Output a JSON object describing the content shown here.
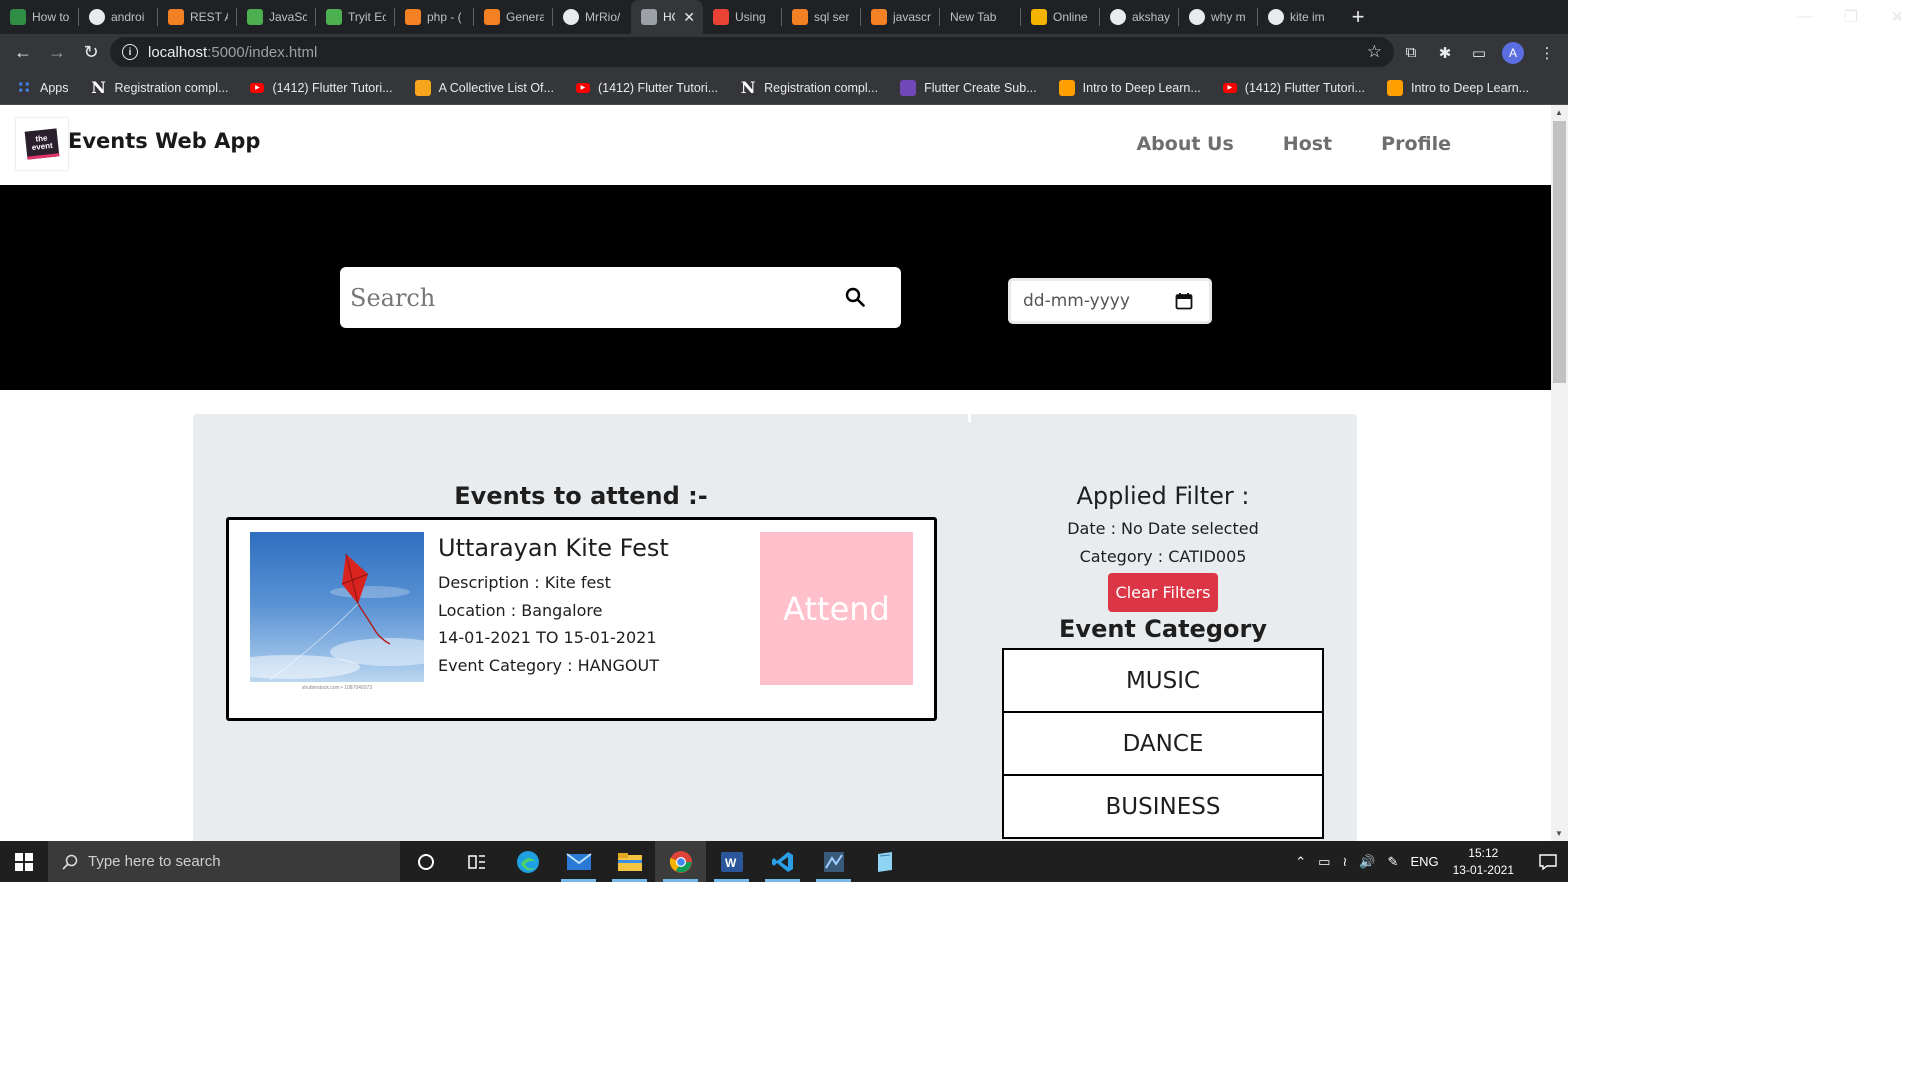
{
  "browser": {
    "tabs": [
      {
        "title": "How to",
        "favicon": "geeks-icon",
        "color": "#2f8d46"
      },
      {
        "title": "androi",
        "favicon": "google-icon",
        "color": "#ffffff"
      },
      {
        "title": "REST A",
        "favicon": "stackoverflow-icon",
        "color": "#f48024"
      },
      {
        "title": "JavaSc",
        "favicon": "w3schools-icon",
        "color": "#4caf50"
      },
      {
        "title": "Tryit Ec",
        "favicon": "w3schools-icon",
        "color": "#4caf50"
      },
      {
        "title": "php - (",
        "favicon": "stackoverflow-icon",
        "color": "#f48024"
      },
      {
        "title": "Genera",
        "favicon": "stackoverflow-icon",
        "color": "#f48024"
      },
      {
        "title": "MrRio/",
        "favicon": "github-icon",
        "color": "#ffffff"
      },
      {
        "title": "HO",
        "favicon": "globe-icon",
        "color": "#9aa0a6",
        "active": true
      },
      {
        "title": "Using",
        "favicon": "gmail-icon",
        "color": "#ea4335"
      },
      {
        "title": "sql ser",
        "favicon": "stackoverflow-icon",
        "color": "#f48024"
      },
      {
        "title": "javascr",
        "favicon": "stackoverflow-icon",
        "color": "#f48024"
      },
      {
        "title": "New Tab",
        "favicon": "",
        "color": ""
      },
      {
        "title": "Online",
        "favicon": "slides-icon",
        "color": "#f4b400"
      },
      {
        "title": "akshay",
        "favicon": "github-icon",
        "color": "#ffffff"
      },
      {
        "title": "why m",
        "favicon": "google-icon",
        "color": "#ffffff"
      },
      {
        "title": "kite im",
        "favicon": "google-icon",
        "color": "#ffffff"
      }
    ],
    "address_host": "localhost",
    "address_path": ":5000/index.html",
    "profile_initial": "A",
    "bookmarks": [
      {
        "label": "Apps",
        "icon": "apps-grid-icon",
        "color": "#4285f4"
      },
      {
        "label": "Registration compl...",
        "icon": "notion-icon",
        "color": "#000000"
      },
      {
        "label": "(1412) Flutter Tutori...",
        "icon": "youtube-icon",
        "color": "#ff0000"
      },
      {
        "label": "A Collective List Of...",
        "icon": "bolt-icon",
        "color": "#f7a51c"
      },
      {
        "label": "(1412) Flutter Tutori...",
        "icon": "youtube-icon",
        "color": "#ff0000"
      },
      {
        "label": "Registration compl...",
        "icon": "notion-icon",
        "color": "#000000"
      },
      {
        "label": "Flutter Create Sub...",
        "icon": "form-icon",
        "color": "#7248b9"
      },
      {
        "label": "Intro to Deep Learn...",
        "icon": "firebase-icon",
        "color": "#ffa000"
      },
      {
        "label": "(1412) Flutter Tutori...",
        "icon": "youtube-icon",
        "color": "#ff0000"
      },
      {
        "label": "Intro to Deep Learn...",
        "icon": "firebase-icon",
        "color": "#ffa000"
      }
    ],
    "bookmarks_overflow": "»"
  },
  "page": {
    "brand": "Events Web App",
    "nav": [
      "About Us",
      "Host",
      "Profile"
    ],
    "search_placeholder": "Search",
    "date_placeholder": "dd-mm-yyyy",
    "events_title": "Events to attend :-",
    "event": {
      "name": "Uttarayan Kite Fest",
      "description": "Description : Kite fest",
      "location": "Location : Bangalore",
      "dates": "14-01-2021 TO 15-01-2021",
      "category": "Event Category : HANGOUT",
      "image_credit": "shutterstock.com • 1087049373",
      "attend_label": "Attend",
      "attend_color": "#ffc0cb"
    },
    "filter": {
      "title": "Applied Filter :",
      "date": "Date : No Date selected",
      "category": "Category : CATID005",
      "clear_label": "Clear Filters",
      "clear_color": "#dc3545"
    },
    "category_title": "Event Category",
    "categories": [
      "MUSIC",
      "DANCE",
      "BUSINESS"
    ]
  },
  "taskbar": {
    "search_placeholder": "Type here to search",
    "apps": [
      "cortana-icon",
      "task-view-icon",
      "edge-icon",
      "mail-icon",
      "file-explorer-icon",
      "chrome-icon",
      "word-icon",
      "vscode-icon",
      "app-icon",
      "notepad-icon"
    ],
    "language": "ENG",
    "time": "15:12",
    "date": "13-01-2021"
  }
}
